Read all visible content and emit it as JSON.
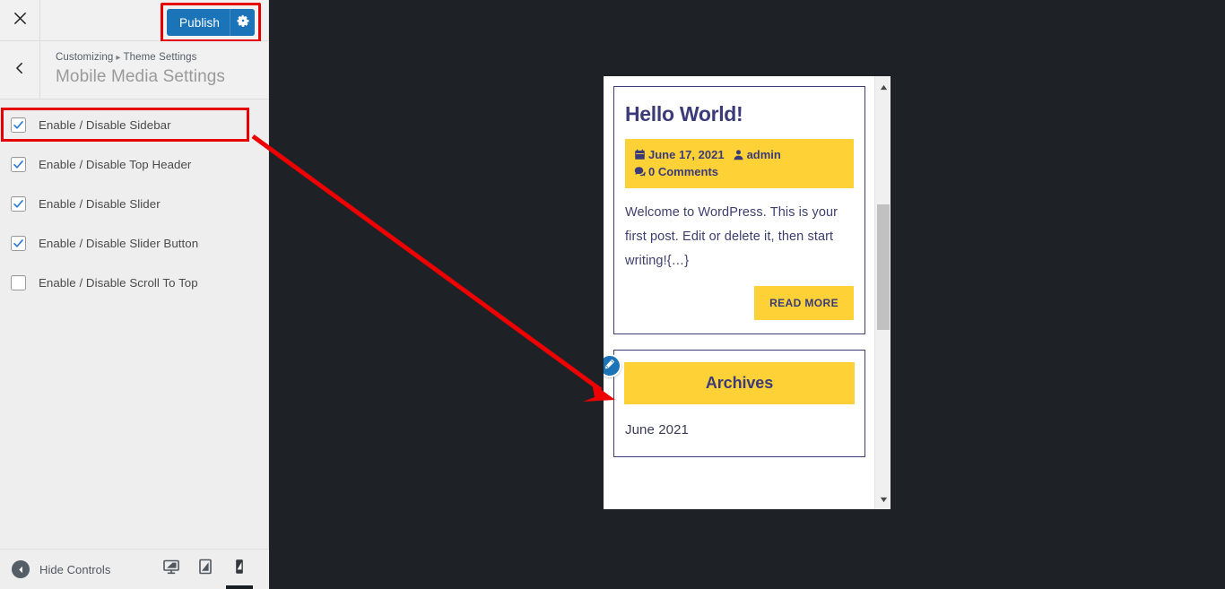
{
  "colors": {
    "accent_blue": "#1b74b8",
    "annotation_red": "#e60000",
    "theme_yellow": "#fed136",
    "theme_navy": "#3b3b79",
    "preview_backdrop": "#1e2226",
    "panel_bg": "#eeeeee"
  },
  "customizer": {
    "close_icon": "close-icon",
    "publish_label": "Publish",
    "publish_gear_icon": "gear-icon",
    "back_icon": "chevron-left-icon",
    "breadcrumb": {
      "root": "Customizing",
      "separator": "▸",
      "section": "Theme Settings"
    },
    "panel_title": "Mobile Media Settings",
    "controls": [
      {
        "label": "Enable / Disable Sidebar",
        "checked": true,
        "highlighted": true
      },
      {
        "label": "Enable / Disable Top Header",
        "checked": true,
        "highlighted": false
      },
      {
        "label": "Enable / Disable Slider",
        "checked": true,
        "highlighted": false
      },
      {
        "label": "Enable / Disable Slider Button",
        "checked": true,
        "highlighted": false
      },
      {
        "label": "Enable / Disable Scroll To Top",
        "checked": false,
        "highlighted": false
      }
    ],
    "footer": {
      "hide_controls_label": "Hide Controls",
      "hide_controls_icon": "collapse-left-icon",
      "devices": [
        {
          "name": "desktop",
          "icon": "desktop-icon",
          "active": false
        },
        {
          "name": "tablet",
          "icon": "tablet-icon",
          "active": false
        },
        {
          "name": "mobile",
          "icon": "mobile-icon",
          "active": true
        }
      ]
    }
  },
  "preview": {
    "scrollbar": {
      "up_icon": "triangle-up-icon",
      "down_icon": "triangle-down-icon"
    },
    "post": {
      "title": "Hello World!",
      "meta": {
        "date_icon": "calendar-icon",
        "date": "June 17, 2021",
        "author_icon": "user-icon",
        "author": "admin",
        "comments_icon": "comments-icon",
        "comments": "0 Comments"
      },
      "excerpt": "Welcome to WordPress. This is your first post. Edit or delete it, then start writing!{…}",
      "read_more_label": "READ MORE"
    },
    "widget": {
      "edit_icon": "pencil-edit-icon",
      "title": "Archives",
      "items": [
        "June 2021"
      ]
    }
  },
  "annotation": {
    "arrow_from": "sidebar-control-highlight",
    "arrow_to": "archives-widget"
  }
}
